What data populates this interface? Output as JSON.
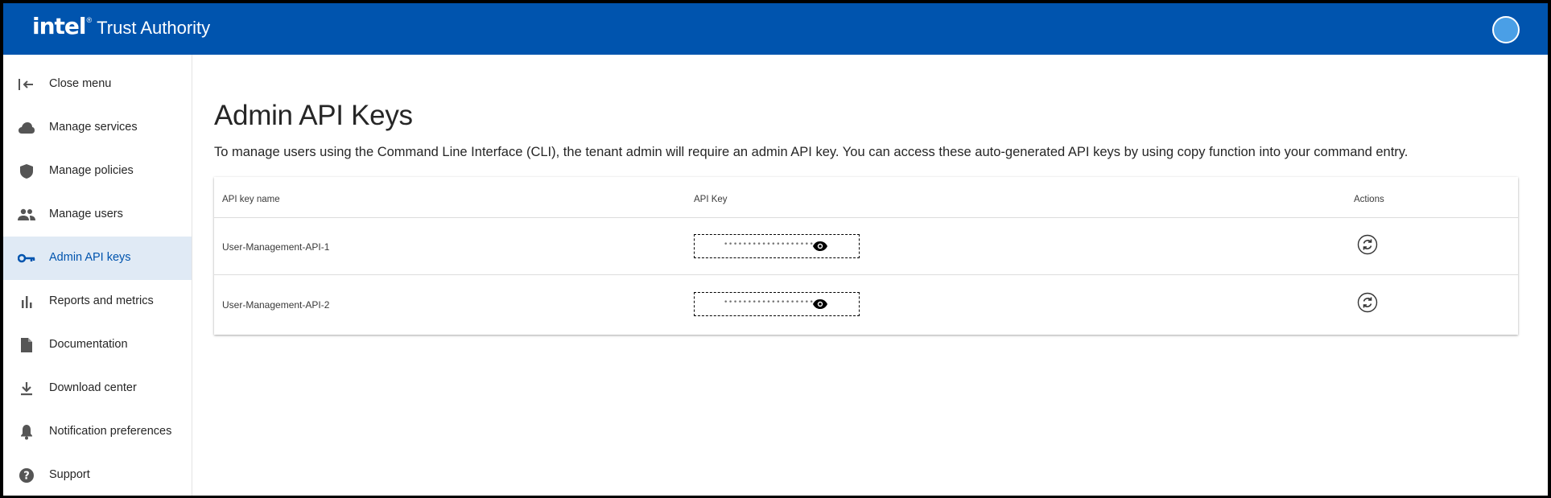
{
  "header": {
    "brand_logo": "intel",
    "brand_reg": "®",
    "brand_product": "Trust Authority",
    "brand_color": "#0054ae",
    "avatar_color": "#4a9fe6"
  },
  "sidebar": {
    "items": [
      {
        "label": "Close menu",
        "icon": "close-menu-icon"
      },
      {
        "label": "Manage services",
        "icon": "cloud-icon"
      },
      {
        "label": "Manage policies",
        "icon": "shield-icon"
      },
      {
        "label": "Manage users",
        "icon": "users-icon"
      },
      {
        "label": "Admin API keys",
        "icon": "key-icon",
        "active": true
      },
      {
        "label": "Reports and metrics",
        "icon": "bar-chart-icon"
      },
      {
        "label": "Documentation",
        "icon": "document-icon"
      },
      {
        "label": "Download center",
        "icon": "download-icon"
      },
      {
        "label": "Notification preferences",
        "icon": "bell-icon"
      },
      {
        "label": "Support",
        "icon": "help-icon"
      }
    ],
    "active_color": "#0054ae",
    "active_bg": "#e0eaf5"
  },
  "main": {
    "title": "Admin API Keys",
    "description": "To manage users using the Command Line Interface (CLI), the tenant admin will require an admin API key. You can access these auto-generated API keys by using copy function into your command entry.",
    "table": {
      "columns": [
        "API key name",
        "API Key",
        "Actions"
      ],
      "rows": [
        {
          "name": "User-Management-API-1",
          "masked_key": "••••••••••••••••••••"
        },
        {
          "name": "User-Management-API-2",
          "masked_key": "••••••••••••••••••••"
        }
      ]
    }
  }
}
